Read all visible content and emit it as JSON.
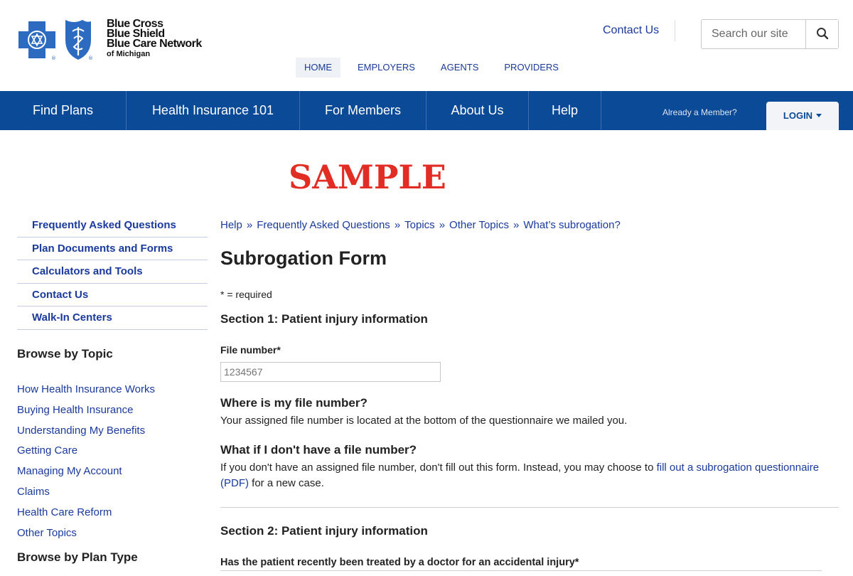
{
  "brand": {
    "line1": "Blue Cross",
    "line2": "Blue Shield",
    "line3": "Blue Care Network",
    "line4": "of Michigan",
    "colors": {
      "primary": "#0a4a97",
      "cross": "#2d6bc0",
      "link": "#1a3a9c",
      "sample": "#e22d24"
    }
  },
  "header": {
    "contact": "Contact Us",
    "search_placeholder": "Search our site",
    "search_icon": "magnifier-icon",
    "audience_nav": [
      "HOME",
      "EMPLOYERS",
      "AGENTS",
      "PROVIDERS"
    ],
    "audience_active": "HOME"
  },
  "main_nav": {
    "items": [
      "Find Plans",
      "Health Insurance 101",
      "For Members",
      "About Us",
      "Help"
    ],
    "already_member": "Already a Member?",
    "login": "LOGIN",
    "login_icon": "caret-down-icon"
  },
  "watermark": "SAMPLE",
  "sidebar": {
    "menu": [
      "Frequently Asked Questions",
      "Plan Documents and Forms",
      "Calculators and Tools",
      "Contact Us",
      "Walk-In Centers"
    ],
    "browse_topic_heading": "Browse by Topic",
    "topics": [
      "How Health Insurance Works",
      "Buying Health Insurance",
      "Understanding My Benefits",
      "Getting Care",
      "Managing My Account",
      "Claims",
      "Health Care Reform",
      "Other Topics"
    ],
    "browse_plan_heading": "Browse by Plan Type"
  },
  "content": {
    "breadcrumb": [
      "Help",
      "Frequently Asked Questions",
      "Topics",
      "Other Topics",
      "What’s subrogation?"
    ],
    "breadcrumb_sep": "»",
    "title": "Subrogation Form",
    "required_note": "* = required",
    "section1": "Section 1: Patient injury information",
    "file_label": "File number*",
    "file_placeholder": "1234567",
    "q1": "Where is my file number?",
    "a1": "Your assigned file number is located at the bottom of the questionnaire we mailed you.",
    "q2": "What if I don't have a file number?",
    "a2_pre": "If you don't have an assigned file number, don't fill out this form. Instead, you may choose to ",
    "a2_link": "fill out a subrogation questionnaire (PDF)",
    "a2_post": " for a new case.",
    "section2": "Section 2: Patient injury information",
    "q3": "Has the patient recently been treated by a doctor for an accidental injury*"
  }
}
